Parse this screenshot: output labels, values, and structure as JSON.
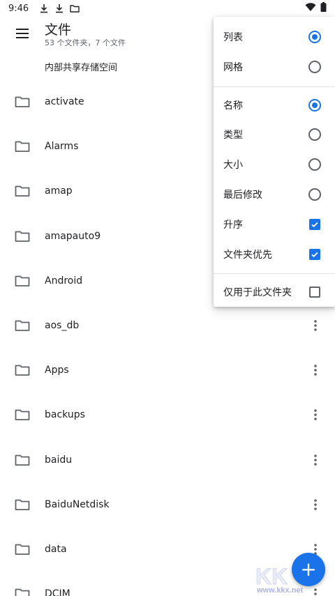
{
  "status_bar": {
    "time": "9:46",
    "icons": [
      "download-icon",
      "download-icon",
      "folder-icon"
    ],
    "right_icons": [
      "wifi-icon",
      "battery-icon"
    ]
  },
  "app_bar": {
    "title": "文件",
    "subtitle": "53 个文件夹，7 个文件",
    "menu_icon": "hamburger-menu-icon"
  },
  "breadcrumb": "内部共享存储空间",
  "files": [
    {
      "name": "activate",
      "show_more": false
    },
    {
      "name": "Alarms",
      "show_more": false
    },
    {
      "name": "amap",
      "show_more": false
    },
    {
      "name": "amapauto9",
      "show_more": false
    },
    {
      "name": "Android",
      "show_more": false
    },
    {
      "name": "aos_db",
      "show_more": true
    },
    {
      "name": "Apps",
      "show_more": true
    },
    {
      "name": "backups",
      "show_more": true
    },
    {
      "name": "baidu",
      "show_more": true
    },
    {
      "name": "BaiduNetdisk",
      "show_more": true
    },
    {
      "name": "data",
      "show_more": true
    },
    {
      "name": "DCIM",
      "show_more": true
    }
  ],
  "popup_menu": {
    "view_group": [
      {
        "label": "列表",
        "type": "radio",
        "checked": true
      },
      {
        "label": "网格",
        "type": "radio",
        "checked": false
      }
    ],
    "sort_group": [
      {
        "label": "名称",
        "type": "radio",
        "checked": true
      },
      {
        "label": "类型",
        "type": "radio",
        "checked": false
      },
      {
        "label": "大小",
        "type": "radio",
        "checked": false
      },
      {
        "label": "最后修改",
        "type": "radio",
        "checked": false
      },
      {
        "label": "升序",
        "type": "checkbox",
        "checked": true
      },
      {
        "label": "文件夹优先",
        "type": "checkbox",
        "checked": true
      }
    ],
    "scope_group": [
      {
        "label": "仅用于此文件夹",
        "type": "checkbox",
        "checked": false
      }
    ]
  },
  "fab": {
    "symbol": "+",
    "icon": "add-icon"
  },
  "watermark": {
    "text": "www.kkx.net"
  },
  "colors": {
    "accent": "#1a73e8",
    "text": "#202124",
    "secondary_text": "#5f6368",
    "divider": "#e0e0e0"
  }
}
